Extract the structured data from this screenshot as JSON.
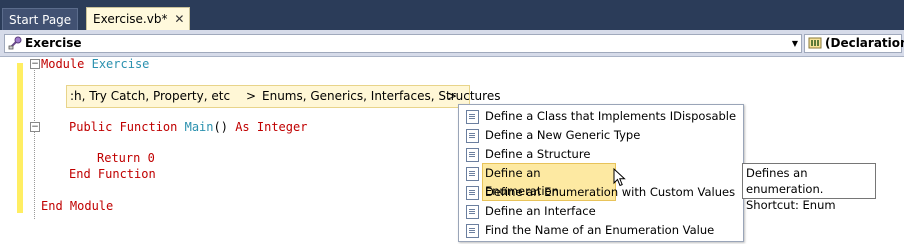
{
  "tabs": [
    {
      "label": "Start Page"
    },
    {
      "label": "Exercise.vb*",
      "close": "✕"
    }
  ],
  "navbar": {
    "left_combo": "Exercise",
    "right_combo": "(Declarations)"
  },
  "code": {
    "line1_kw": "Module",
    "line1_name": "Exercise",
    "line2_kw1": "Public Function",
    "line2_name": "Main",
    "line2_rest": "()",
    "line2_kw2": "As Integer",
    "line3_kw": "Return",
    "line3_val": "0",
    "line4": "End Function",
    "line5": "End Module"
  },
  "breadcrumb": {
    "item1": ":h, Try Catch, Property, etc",
    "sep1": ">",
    "item2": "Enums, Generics, Interfaces, Structures",
    "sep2": ">"
  },
  "snippets": [
    "Define a Class that Implements IDisposable",
    "Define a New Generic Type",
    "Define a Structure",
    "Define an Enumeration",
    "Define an Enumeration with Custom Values",
    "Define an Interface",
    "Find the Name of an Enumeration Value"
  ],
  "selected_snippet_index": 3,
  "tooltip": {
    "line1": "Defines an enumeration.",
    "line2": "Shortcut: Enum"
  },
  "outline_toggles": [
    "−",
    "−"
  ]
}
